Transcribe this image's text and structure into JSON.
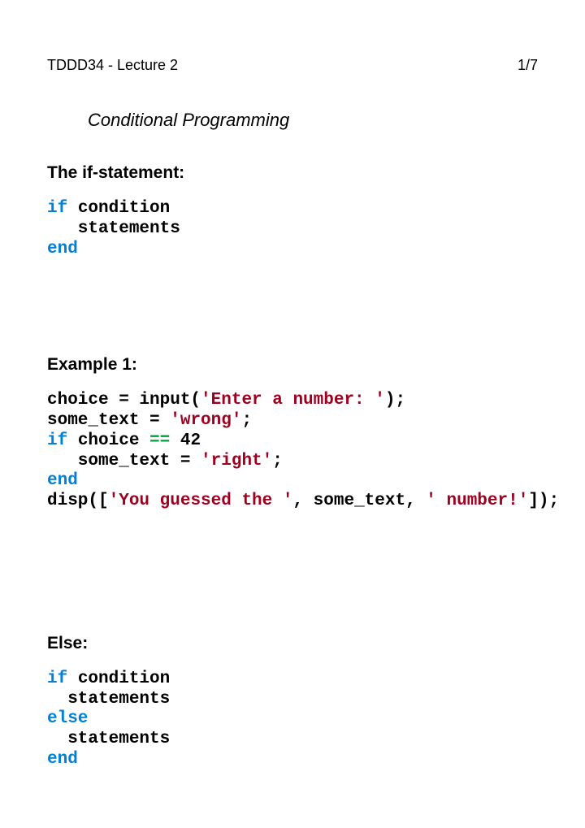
{
  "header": {
    "left": "TDDD34 - Lecture 2",
    "right": "1/7"
  },
  "title": "Conditional Programming",
  "sections": {
    "s1": {
      "heading": "The if-statement:",
      "code": {
        "kw_if": "if",
        "cond": " condition",
        "stmts": "   statements",
        "kw_end": "end"
      }
    },
    "s2": {
      "heading": "Example 1:",
      "code": {
        "l1a": "choice = input(",
        "l1s": "'Enter a number: '",
        "l1b": ");",
        "l2a": "some_text = ",
        "l2s": "'wrong'",
        "l2b": ";",
        "l3if": "if",
        "l3a": " choice ",
        "l3eq": "==",
        "l3b": " 42",
        "l4a": "   some_text = ",
        "l4s": "'right'",
        "l4b": ";",
        "l5end": "end",
        "l6a": "disp([",
        "l6s1": "'You guessed the '",
        "l6b": ", some_text, ",
        "l6s2": "' number!'",
        "l6c": "]);"
      }
    },
    "s3": {
      "heading": "Else:",
      "code": {
        "kw_if": "if",
        "cond": " condition",
        "stmts1": "  statements",
        "kw_else": "else",
        "stmts2": "  statements",
        "kw_end": "end"
      }
    }
  }
}
